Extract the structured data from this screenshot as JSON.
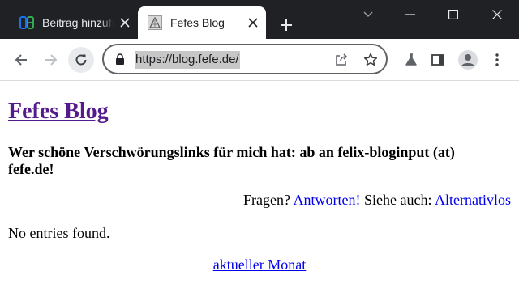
{
  "browser": {
    "tabs": [
      {
        "title": "Beitrag hinzufügen",
        "active": false
      },
      {
        "title": "Fefes Blog",
        "active": true
      }
    ],
    "url": "https://blog.fefe.de/",
    "colors": {
      "frame": "#202124",
      "tab_active": "#ffffff",
      "inactive_favicon": "#34a853"
    }
  },
  "page": {
    "title": "Fefes Blog",
    "tagline": "Wer schöne Verschwörungslinks für mich hat: ab an felix-bloginput (at) fefe.de!",
    "links_line": {
      "prefix": "Fragen?",
      "answers_link": "Antworten!",
      "middle": "Siehe auch:",
      "alt_link": "Alternativlos"
    },
    "empty_message": "No entries found.",
    "month_link": "aktueller Monat"
  }
}
